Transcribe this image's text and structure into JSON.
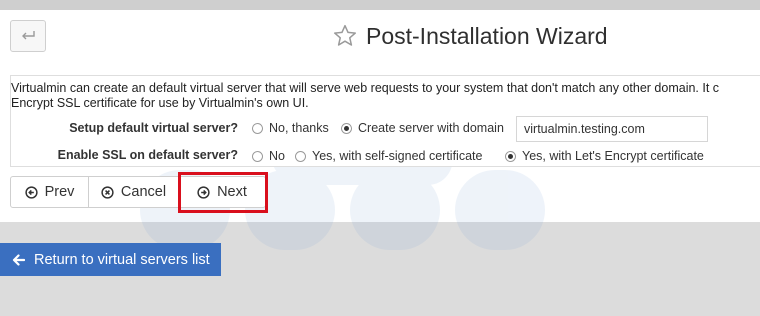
{
  "header": {
    "back_icon": "return-arrow-icon",
    "star_icon": "star-outline-icon",
    "title": "Post-Installation Wizard"
  },
  "form": {
    "description_line1": "Virtualmin can create an default virtual server that will serve web requests to your system that don't match any other domain. It c",
    "description_line2": "Encrypt SSL certificate for use by Virtualmin's own UI.",
    "default_server": {
      "label": "Setup default virtual server?",
      "options": [
        "No, thanks",
        "Create server with domain"
      ],
      "selected": "Create server with domain",
      "domain_value": "virtualmin.testing.com"
    },
    "ssl": {
      "label": "Enable SSL on default server?",
      "options": [
        "No",
        "Yes, with self-signed certificate",
        "Yes, with Let's Encrypt certificate"
      ],
      "selected": "Yes, with Let's Encrypt certificate"
    }
  },
  "buttons": {
    "prev": "Prev",
    "cancel": "Cancel",
    "next": "Next",
    "highlighted": "Next"
  },
  "footer": {
    "return_label": "Return to virtual servers list",
    "return_icon": "arrow-left-icon"
  },
  "colors": {
    "primary_button": "#3a6fc0",
    "highlight_border": "#d90f1d",
    "page_background": "#dcdcdc"
  }
}
